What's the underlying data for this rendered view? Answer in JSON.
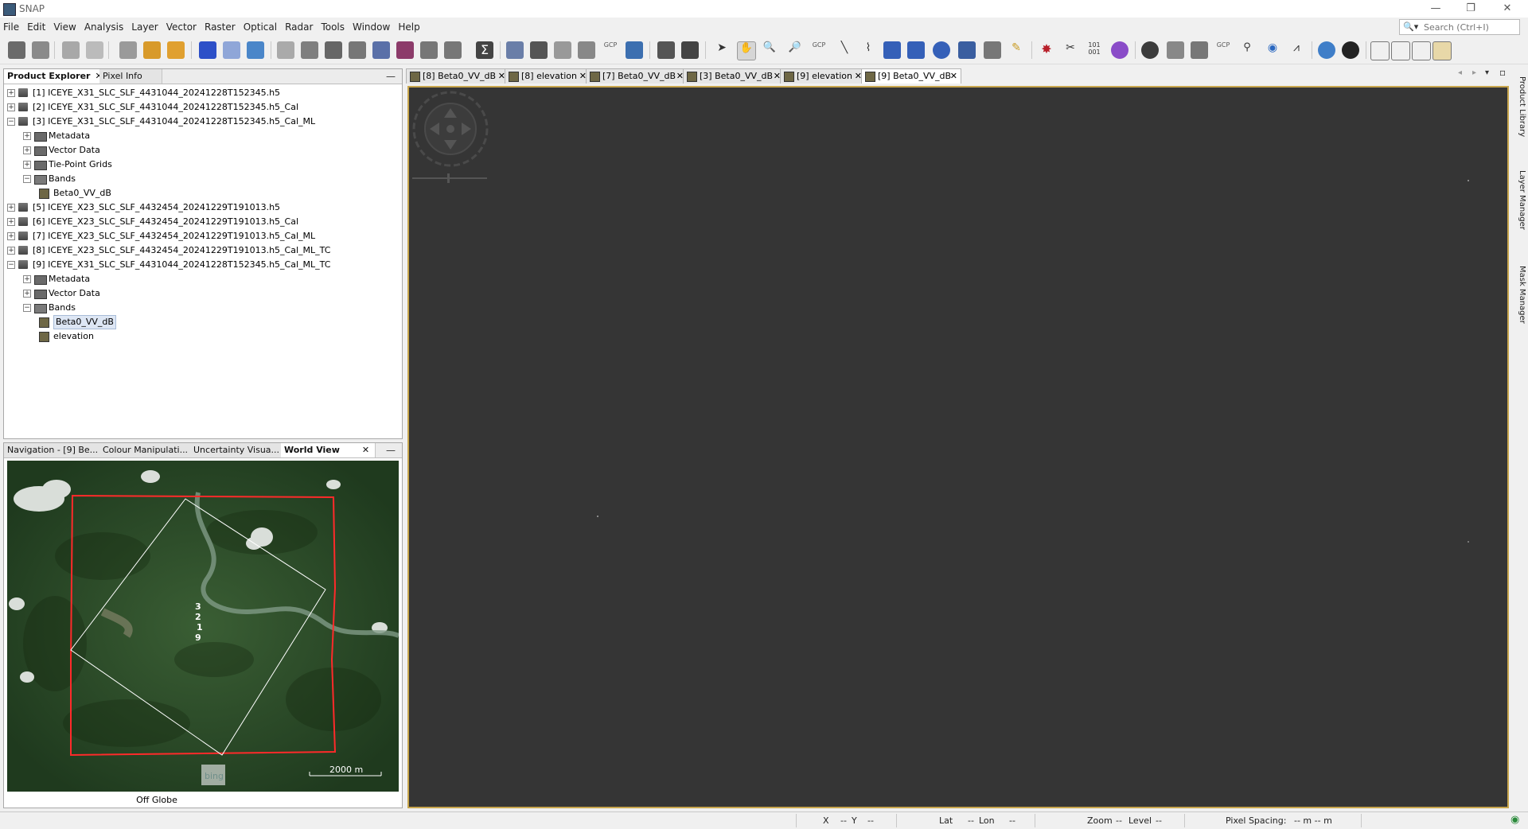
{
  "window": {
    "title": "SNAP",
    "controls": [
      "—",
      "❐",
      "✕"
    ]
  },
  "menu": [
    "File",
    "Edit",
    "View",
    "Analysis",
    "Layer",
    "Vector",
    "Raster",
    "Optical",
    "Radar",
    "Tools",
    "Window",
    "Help"
  ],
  "search": {
    "placeholder": "Search (Ctrl+I)"
  },
  "toolbar_icons": {
    "gcp_a": "GCP",
    "gcp_b": "GCP",
    "gcp_c": "GCP",
    "bin": "101\n001"
  },
  "explorer": {
    "tabs": [
      "Product Explorer",
      "Pixel Info"
    ],
    "tree": [
      {
        "label": "[1] ICEYE_X31_SLC_SLF_4431044_20241228T152345.h5",
        "level": 0,
        "kind": "product",
        "exp": "+"
      },
      {
        "label": "[2] ICEYE_X31_SLC_SLF_4431044_20241228T152345.h5_Cal",
        "level": 0,
        "kind": "product",
        "exp": "+"
      },
      {
        "label": "[3] ICEYE_X31_SLC_SLF_4431044_20241228T152345.h5_Cal_ML",
        "level": 0,
        "kind": "product",
        "exp": "−"
      },
      {
        "label": "Metadata",
        "level": 1,
        "kind": "folder",
        "exp": "+"
      },
      {
        "label": "Vector Data",
        "level": 1,
        "kind": "folder",
        "exp": "+"
      },
      {
        "label": "Tie-Point Grids",
        "level": 1,
        "kind": "folder",
        "exp": "+"
      },
      {
        "label": "Bands",
        "level": 1,
        "kind": "folder-open",
        "exp": "−"
      },
      {
        "label": "Beta0_VV_dB",
        "level": 2,
        "kind": "band",
        "exp": ""
      },
      {
        "label": "[5] ICEYE_X23_SLC_SLF_4432454_20241229T191013.h5",
        "level": 0,
        "kind": "product",
        "exp": "+"
      },
      {
        "label": "[6] ICEYE_X23_SLC_SLF_4432454_20241229T191013.h5_Cal",
        "level": 0,
        "kind": "product",
        "exp": "+"
      },
      {
        "label": "[7] ICEYE_X23_SLC_SLF_4432454_20241229T191013.h5_Cal_ML",
        "level": 0,
        "kind": "product",
        "exp": "+"
      },
      {
        "label": "[8] ICEYE_X23_SLC_SLF_4432454_20241229T191013.h5_Cal_ML_TC",
        "level": 0,
        "kind": "product",
        "exp": "+"
      },
      {
        "label": "[9] ICEYE_X31_SLC_SLF_4431044_20241228T152345.h5_Cal_ML_TC",
        "level": 0,
        "kind": "product",
        "exp": "−"
      },
      {
        "label": "Metadata",
        "level": 1,
        "kind": "folder",
        "exp": "+"
      },
      {
        "label": "Vector Data",
        "level": 1,
        "kind": "folder",
        "exp": "+"
      },
      {
        "label": "Bands",
        "level": 1,
        "kind": "folder-open",
        "exp": "−"
      },
      {
        "label": "Beta0_VV_dB",
        "level": 2,
        "kind": "band",
        "exp": "",
        "selected": true
      },
      {
        "label": "elevation",
        "level": 2,
        "kind": "band",
        "exp": ""
      }
    ]
  },
  "lower_panel": {
    "tabs": [
      "Navigation - [9] Be...",
      "Colour Manipulati...",
      "Uncertainty Visua...",
      "World View"
    ],
    "active_tab": 3,
    "map_labels": [
      "3",
      "2",
      "1",
      "9"
    ],
    "scale_label": "2000 m",
    "logo": "bing",
    "footer": "Off Globe"
  },
  "image_tabs": [
    {
      "label": "[8] Beta0_VV_dB"
    },
    {
      "label": "[8] elevation"
    },
    {
      "label": "[7] Beta0_VV_dB"
    },
    {
      "label": "[3] Beta0_VV_dB"
    },
    {
      "label": "[9] elevation"
    },
    {
      "label": "[9] Beta0_VV_dB",
      "active": true
    }
  ],
  "right_side_tabs": [
    "Product Library",
    "Layer Manager",
    "Mask Manager"
  ],
  "status": {
    "x": "X",
    "x_val": "--",
    "y": "Y",
    "y_val": "--",
    "lat": "Lat",
    "lat_val": "--",
    "lon": "Lon",
    "lon_val": "--",
    "zoom": "Zoom",
    "zoom_val": "--",
    "level": "Level",
    "level_val": "--",
    "pixel_spacing": "Pixel Spacing:",
    "pixel_spacing_val": "-- m -- m"
  },
  "colors": {
    "canvas": "#353535",
    "canvas_border": "#c8a64d",
    "footprint": "#ff2a2a",
    "forest": "#2a4a28"
  }
}
